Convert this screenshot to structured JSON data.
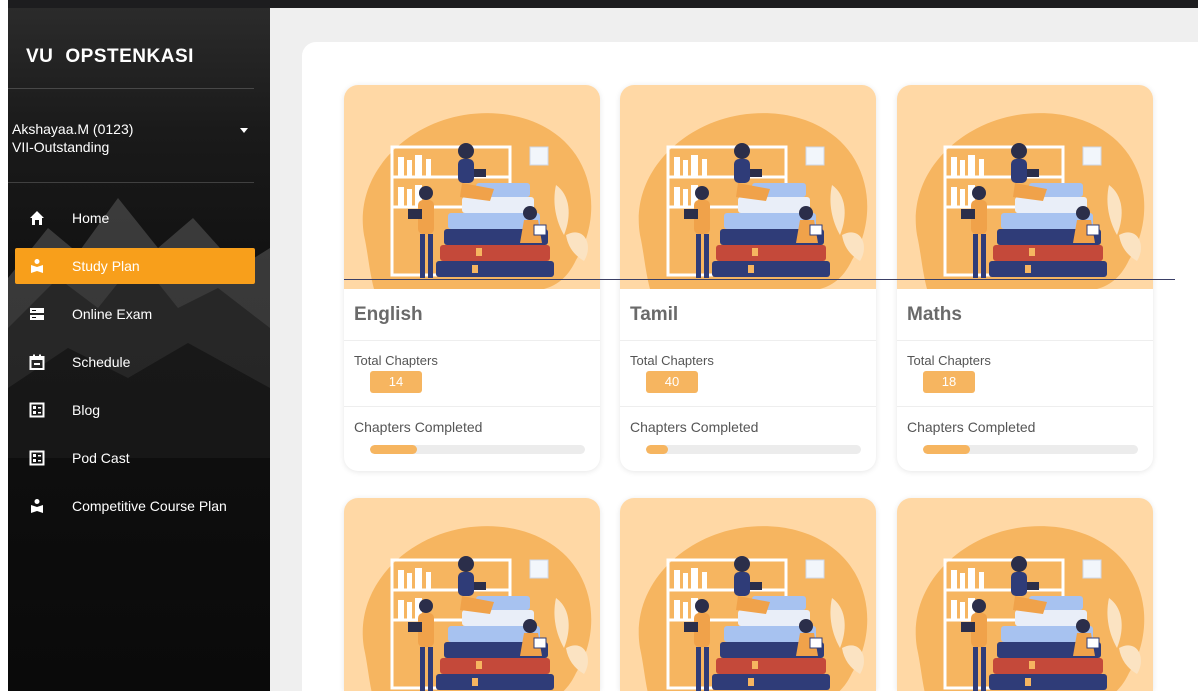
{
  "brand": {
    "part1": "VU",
    "part2": "OPSTENKASI"
  },
  "profile": {
    "name": "Akshayaa.M (0123)",
    "class": "VII-Outstanding"
  },
  "nav": [
    {
      "label": "Home",
      "icon": "home-icon"
    },
    {
      "label": "Study Plan",
      "icon": "study-plan-icon",
      "active": true
    },
    {
      "label": "Online Exam",
      "icon": "exam-icon"
    },
    {
      "label": "Schedule",
      "icon": "calendar-icon"
    },
    {
      "label": "Blog",
      "icon": "blog-icon"
    },
    {
      "label": "Pod Cast",
      "icon": "podcast-icon"
    },
    {
      "label": "Competitive Course Plan",
      "icon": "course-icon"
    }
  ],
  "cards": [
    {
      "subject": "English",
      "total_label": "Total Chapters",
      "total": "14",
      "done_label": "Chapters Completed",
      "progress": 0.22
    },
    {
      "subject": "Tamil",
      "total_label": "Total Chapters",
      "total": "40",
      "done_label": "Chapters Completed",
      "progress": 0.1
    },
    {
      "subject": "Maths",
      "total_label": "Total Chapters",
      "total": "18",
      "done_label": "Chapters Completed",
      "progress": 0.22
    }
  ],
  "colors": {
    "accent": "#f89f1b",
    "badge": "#f6b560",
    "card_bg": "#ffd8a5"
  }
}
